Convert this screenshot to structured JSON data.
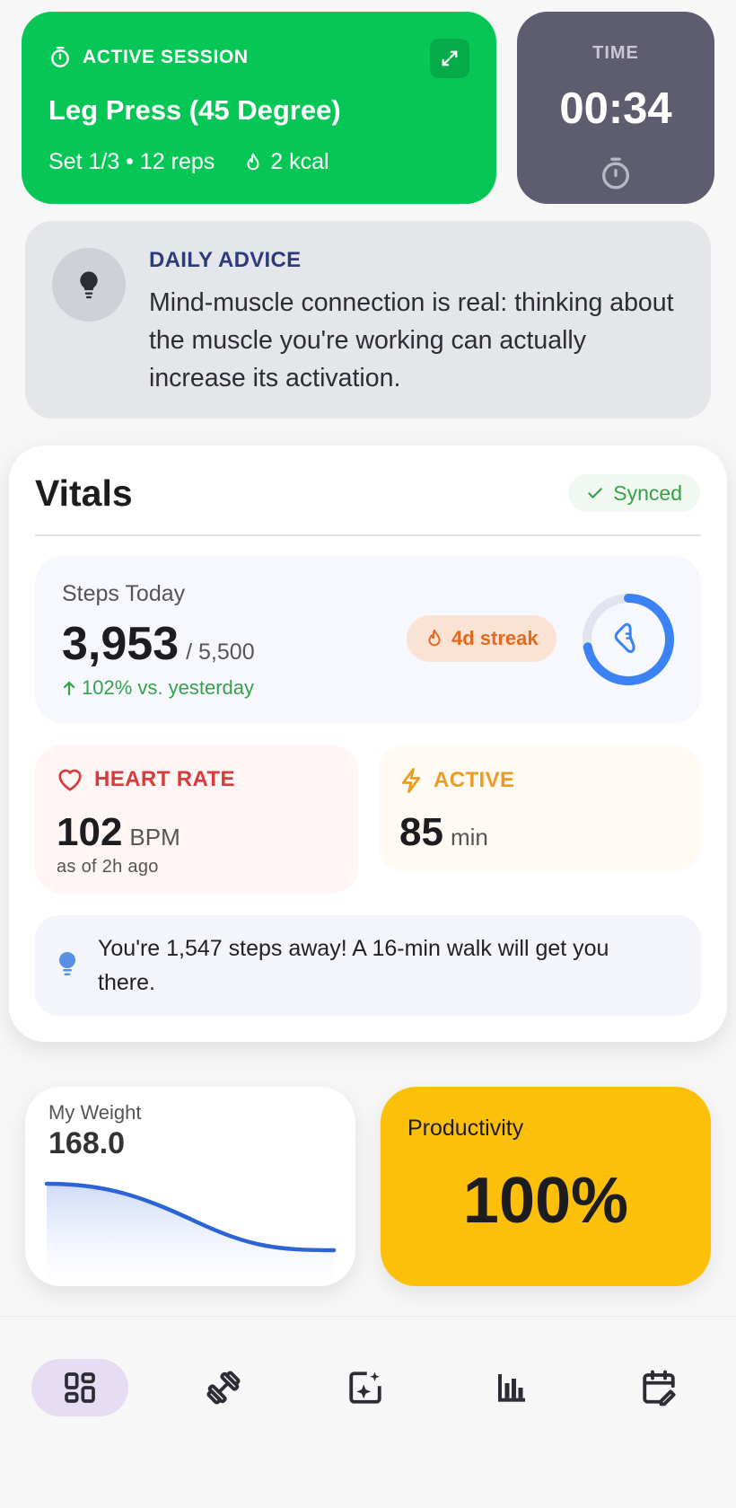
{
  "session": {
    "label": "ACTIVE SESSION",
    "exercise": "Leg Press (45 Degree)",
    "set_info": "Set 1/3 • 12 reps",
    "kcal": "2 kcal",
    "bg_color": "#06c755"
  },
  "timer": {
    "label": "TIME",
    "value": "00:34"
  },
  "advice": {
    "label": "DAILY ADVICE",
    "text": "Mind-muscle connection is real: thinking about the muscle you're working can actually increase its activation."
  },
  "vitals": {
    "title": "Vitals",
    "sync_status": "Synced",
    "steps": {
      "label": "Steps Today",
      "value": "3,953",
      "goal": "/ 5,500",
      "delta": "102% vs. yesterday",
      "streak": "4d streak",
      "progress": 0.72
    },
    "heart_rate": {
      "label": "HEART RATE",
      "value": "102",
      "unit": "BPM",
      "as_of": "as of 2h ago"
    },
    "active": {
      "label": "ACTIVE",
      "value": "85",
      "unit": "min"
    },
    "tip": "You're 1,547 steps away! A 16-min walk will get you there."
  },
  "weight": {
    "label": "My Weight",
    "value": "168.0"
  },
  "productivity": {
    "label": "Productivity",
    "value": "100%",
    "color": "#fcbf0a"
  },
  "nav": [
    {
      "name": "dashboard",
      "icon": "dashboard-icon",
      "active": true
    },
    {
      "name": "workouts",
      "icon": "dumbbell-icon",
      "active": false
    },
    {
      "name": "ai",
      "icon": "sparkle-image-icon",
      "active": false
    },
    {
      "name": "stats",
      "icon": "bar-chart-icon",
      "active": false
    },
    {
      "name": "calendar",
      "icon": "calendar-edit-icon",
      "active": false
    }
  ]
}
